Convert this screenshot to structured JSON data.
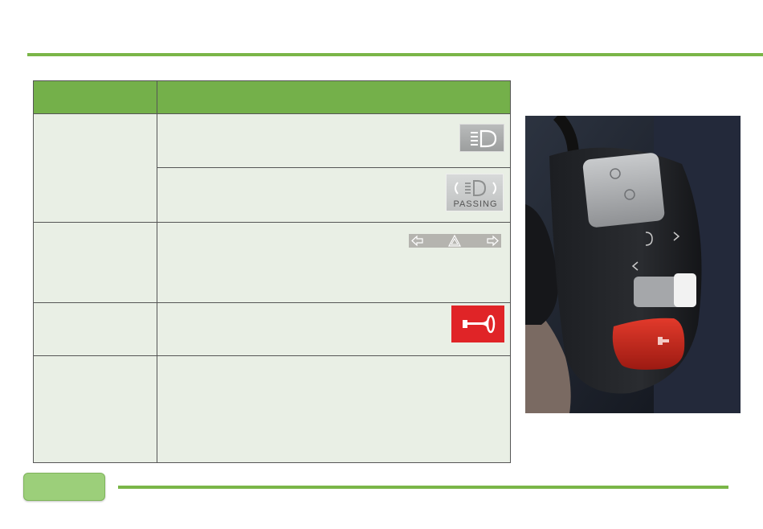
{
  "colors": {
    "accent_green": "#74b04a",
    "table_fill": "#e9efe5",
    "horn_red": "#e02427"
  },
  "table": {
    "header": {
      "col1": "",
      "col2": ""
    },
    "icons": {
      "headlight": "headlight-beam-icon",
      "passing": "passing-light-icon",
      "passing_text": "PASSING",
      "turn_signal": "turn-signal-hazard-icon",
      "horn": "horn-icon"
    }
  },
  "photo": {
    "subject": "handlebar-switch-photo"
  }
}
